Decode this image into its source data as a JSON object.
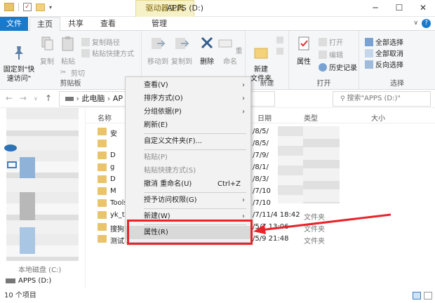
{
  "window": {
    "title": "APPS (D:)",
    "contextual_tab_header": "驱动器工具"
  },
  "title_buttons": [
    "─",
    "☐",
    "✕"
  ],
  "tabs": {
    "file": "文件",
    "home": "主页",
    "share": "共享",
    "view": "查看",
    "manage": "管理"
  },
  "ribbon": {
    "pin": "固定到\"快\n速访问\"",
    "copy": "复制",
    "paste": "粘贴",
    "copy_path": "复制路径",
    "paste_shortcut": "粘贴快捷方式",
    "cut": "剪切",
    "clipboard_group": "剪贴板",
    "move_to": "移动到",
    "copy_to": "复制到",
    "delete": "删除",
    "rename": "重命名",
    "new_folder": "新建\n文件夹",
    "new_group": "新建",
    "properties": "属性",
    "open": "打开",
    "edit": "编辑",
    "history": "历史记录",
    "open_group": "打开",
    "select_all": "全部选择",
    "select_none": "全部取消",
    "invert": "反向选择",
    "select_group": "选择"
  },
  "address": {
    "path_root": "此电脑",
    "path_partial": "AP",
    "search_placeholder": "搜索\"APPS (D:)\""
  },
  "columns": {
    "name": "名称",
    "date": "日期",
    "type": "类型",
    "size": "大小"
  },
  "nav_bottom": {
    "partial": "本地磁盘 (C:)",
    "apps": "APPS (D:)"
  },
  "files": [
    {
      "name": "安",
      "date": "/8/5/",
      "type": ""
    },
    {
      "name": "",
      "date": "/8/5/",
      "type": ""
    },
    {
      "name": "D",
      "date": "/7/9/",
      "type": ""
    },
    {
      "name": "g",
      "date": "/8/1/",
      "type": ""
    },
    {
      "name": "D",
      "date": "/8/3/",
      "type": ""
    },
    {
      "name": "M",
      "date": "/7/10",
      "type": ""
    },
    {
      "name": "Tools",
      "date": "/7/10",
      "type": ""
    },
    {
      "name": "yk_te",
      "date": "/7/11/4 18:42",
      "type": "文件夹"
    },
    {
      "name": "搜狗高",
      "date": "/5/7 13:06",
      "type": "文件夹"
    },
    {
      "name": "测试",
      "date": "/5/9 21:48",
      "type": "文件夹"
    }
  ],
  "status": "10 个项目",
  "context_menu": {
    "view": "查看(V)",
    "sort": "排序方式(O)",
    "group": "分组依据(P)",
    "refresh": "刷新(E)",
    "customize": "自定义文件夹(F)...",
    "paste": "粘贴(P)",
    "paste_shortcut": "粘贴快捷方式(S)",
    "undo": "撤消 重命名(U)",
    "undo_shortcut": "Ctrl+Z",
    "give_access": "授予访问权限(G)",
    "new": "新建(W)",
    "properties": "属性(R)"
  },
  "colors": {
    "file_tab": "#1979ca",
    "highlight_box": "#e8242b",
    "arrow": "#e8242b"
  }
}
